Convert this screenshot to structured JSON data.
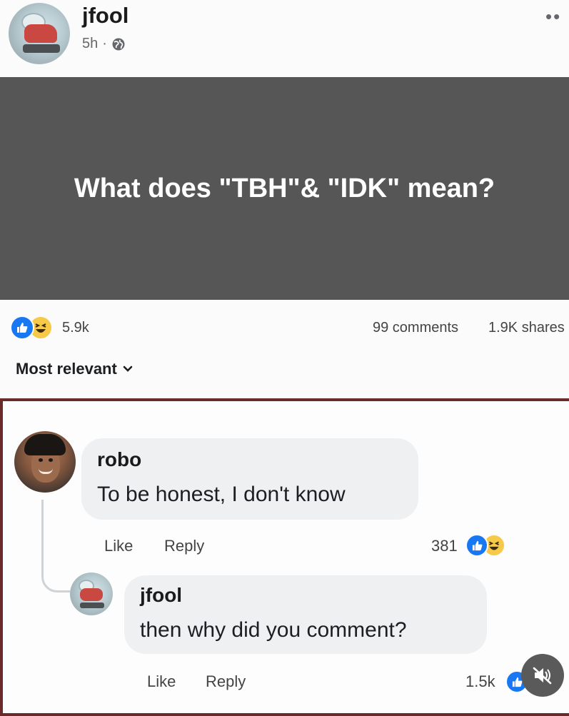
{
  "post": {
    "author": "jfool",
    "time": "5h",
    "dot": "·",
    "more": "••",
    "text": "What does \"TBH\"& \"IDK\" mean?"
  },
  "stats": {
    "reactions": "5.9k",
    "comments": "99 comments",
    "shares": "1.9K shares"
  },
  "sort": {
    "label": "Most relevant"
  },
  "comments": [
    {
      "author": "robo",
      "text": "To be honest, I don't know",
      "like_label": "Like",
      "reply_label": "Reply",
      "reaction_count": "381"
    },
    {
      "author": "jfool",
      "text": "then why did you comment?",
      "like_label": "Like",
      "reply_label": "Reply",
      "reaction_count": "1.5k"
    }
  ],
  "colors": {
    "like_blue": "#1877f2",
    "haha_yellow": "#f7c948",
    "post_background": "#575656",
    "highlight_border": "#6b2a2a"
  },
  "icons": [
    "globe-icon",
    "like-icon",
    "haha-icon",
    "chevron-down-icon",
    "more-icon",
    "mute-icon"
  ]
}
